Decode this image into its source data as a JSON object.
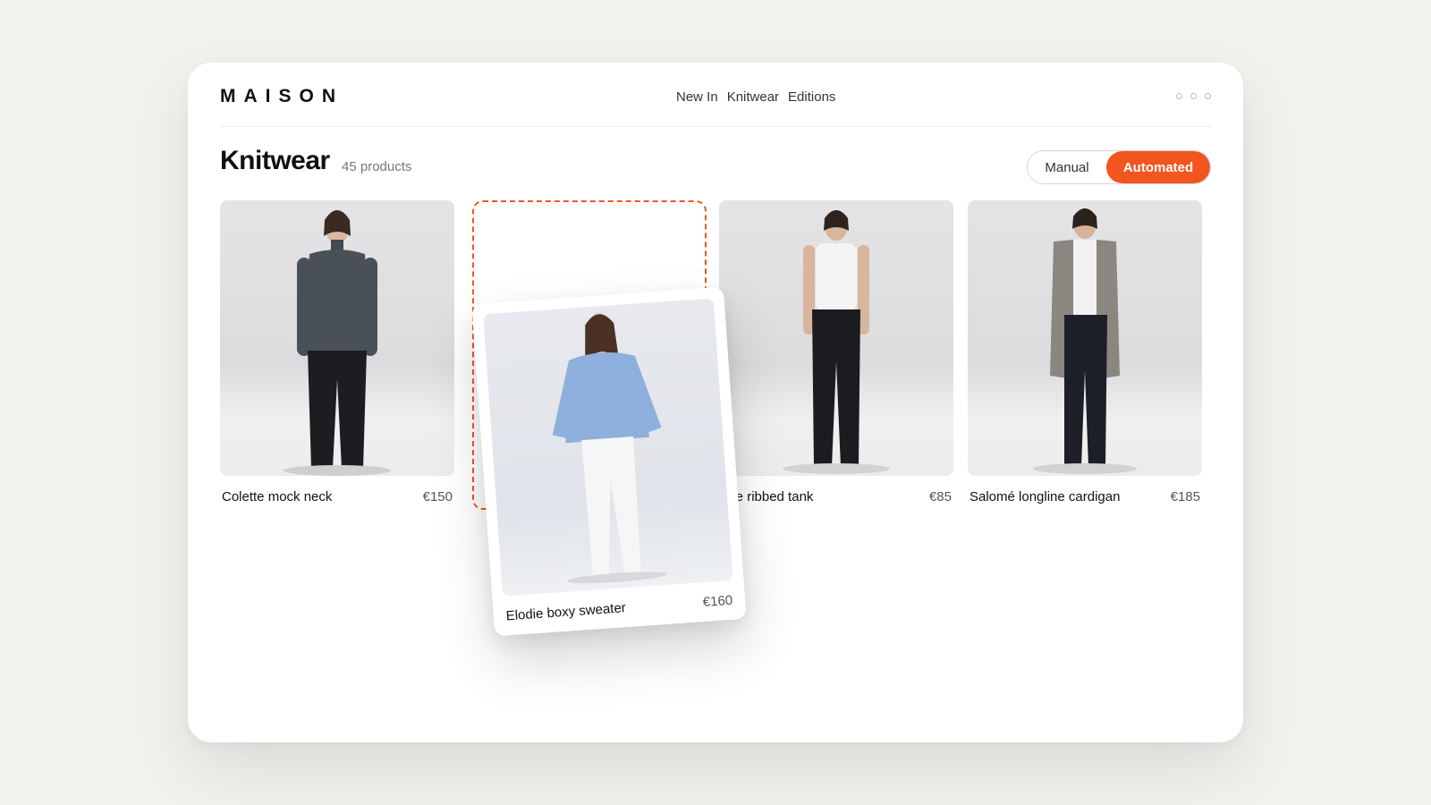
{
  "brand": {
    "logo": "MAISON"
  },
  "nav": {
    "items": [
      "New In",
      "Knitwear",
      "Editions"
    ]
  },
  "page": {
    "title": "Knitwear",
    "count": "45 products"
  },
  "sort_toggle": {
    "manual": "Manual",
    "automated": "Automated",
    "selected": "Automated"
  },
  "colors": {
    "accent": "#f2551d"
  },
  "products": [
    {
      "name": "Colette mock neck",
      "price": "€150"
    },
    {
      "name": "ane ribbed tank",
      "price": "€85"
    },
    {
      "name": "Salomé longline cardigan",
      "price": "€185"
    }
  ],
  "dragging": {
    "name": "Elodie boxy sweater",
    "price": "€160"
  }
}
